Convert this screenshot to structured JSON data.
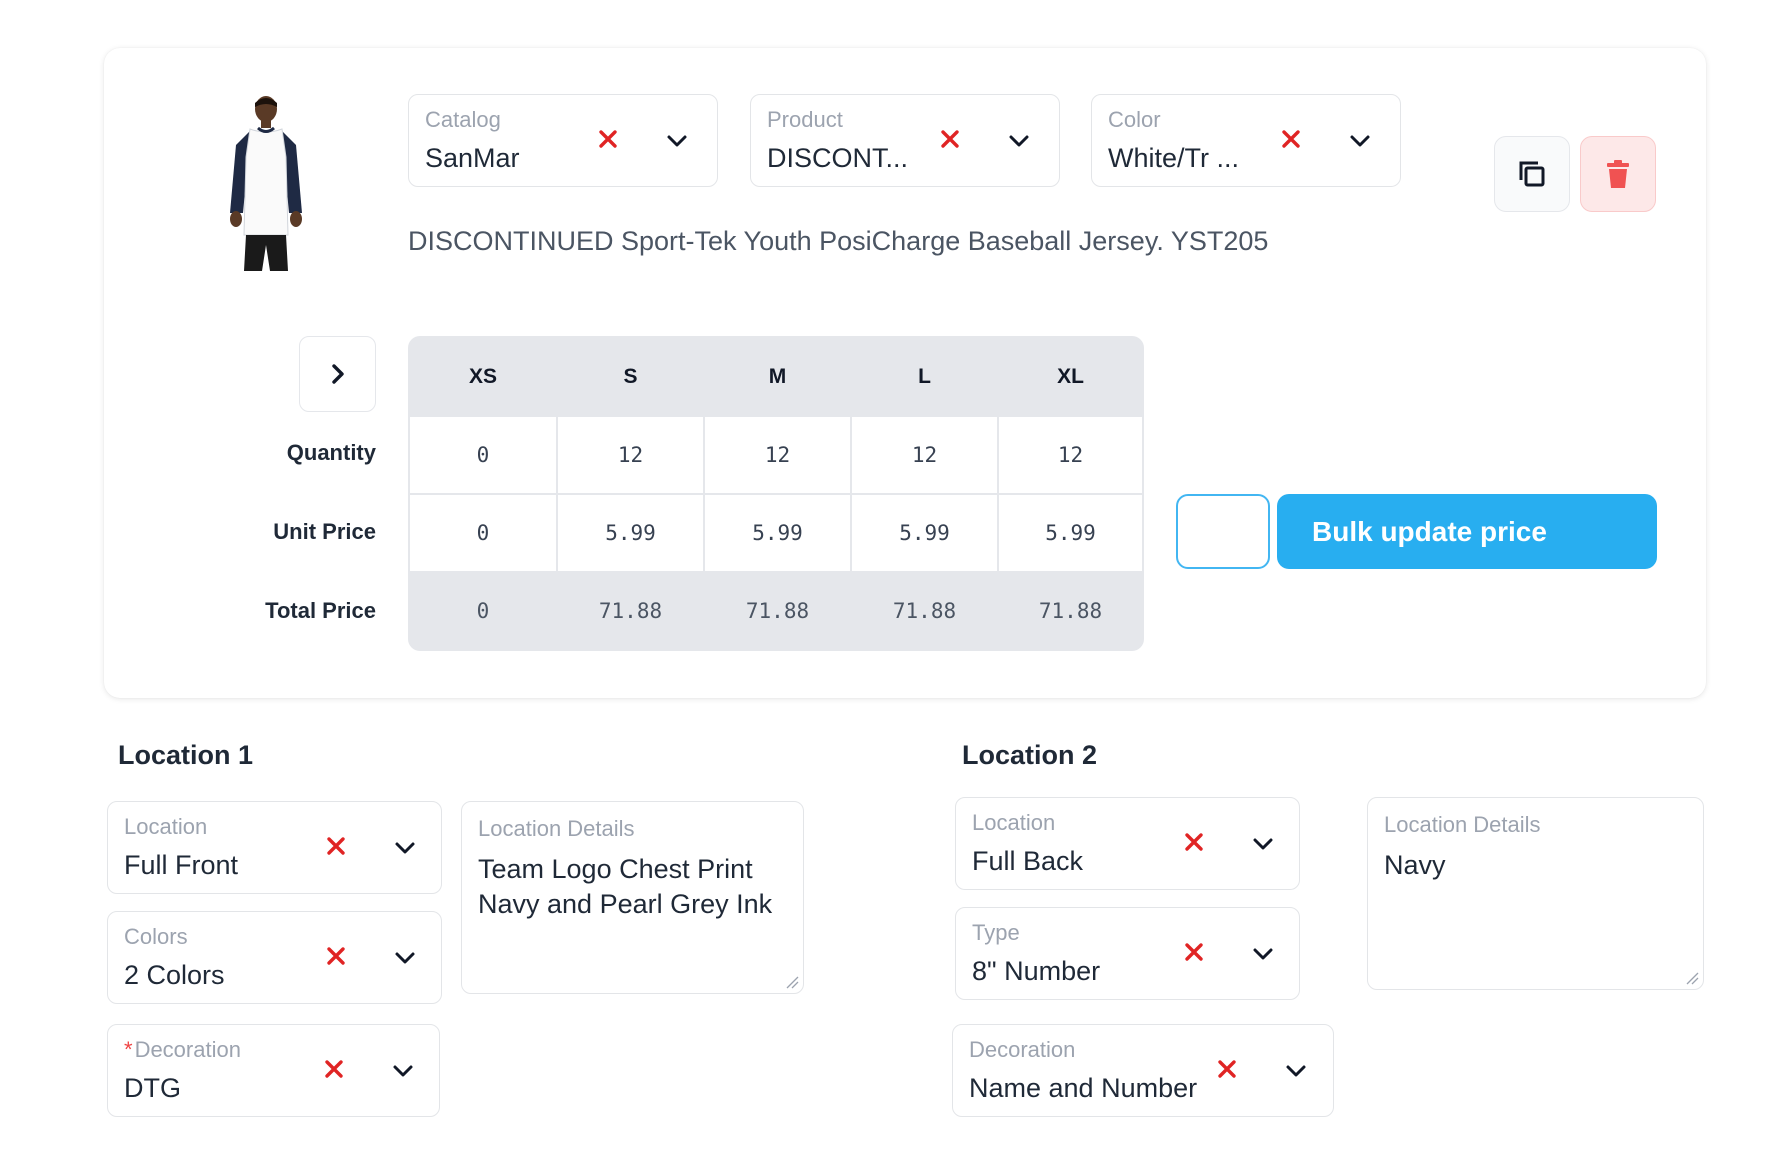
{
  "product": {
    "catalog": {
      "label": "Catalog",
      "value": "SanMar"
    },
    "product_field": {
      "label": "Product",
      "value": "DISCONT..."
    },
    "color": {
      "label": "Color",
      "value": "White/Tr ..."
    },
    "description": "DISCONTINUED Sport-Tek Youth PosiCharge Baseball Jersey. YST205"
  },
  "sizes": {
    "headers": [
      "XS",
      "S",
      "M",
      "L",
      "XL"
    ],
    "row_labels": {
      "quantity": "Quantity",
      "unit_price": "Unit Price",
      "total_price": "Total Price"
    },
    "quantity": [
      "0",
      "12",
      "12",
      "12",
      "12"
    ],
    "unit_price": [
      "0",
      "5.99",
      "5.99",
      "5.99",
      "5.99"
    ],
    "total_price": [
      "0",
      "71.88",
      "71.88",
      "71.88",
      "71.88"
    ]
  },
  "bulk": {
    "input_value": "",
    "button_label": "Bulk update price"
  },
  "location1": {
    "heading": "Location 1",
    "location": {
      "label": "Location",
      "value": "Full Front"
    },
    "colors": {
      "label": "Colors",
      "value": "2 Colors"
    },
    "decoration": {
      "label": "Decoration",
      "required_mark": "*",
      "value": "DTG"
    },
    "details": {
      "label": "Location Details",
      "value": "Team Logo Chest Print\nNavy and Pearl Grey Ink"
    }
  },
  "location2": {
    "heading": "Location 2",
    "location": {
      "label": "Location",
      "value": "Full Back"
    },
    "type": {
      "label": "Type",
      "value": "8\" Number"
    },
    "decoration": {
      "label": "Decoration",
      "value": "Name and Number"
    },
    "details": {
      "label": "Location Details",
      "value": "Navy"
    }
  },
  "colors": {
    "clear_red": "#e02424",
    "accent_blue": "#28aef0",
    "delete_red": "#f05252",
    "jersey_navy": "#1f2a44"
  }
}
